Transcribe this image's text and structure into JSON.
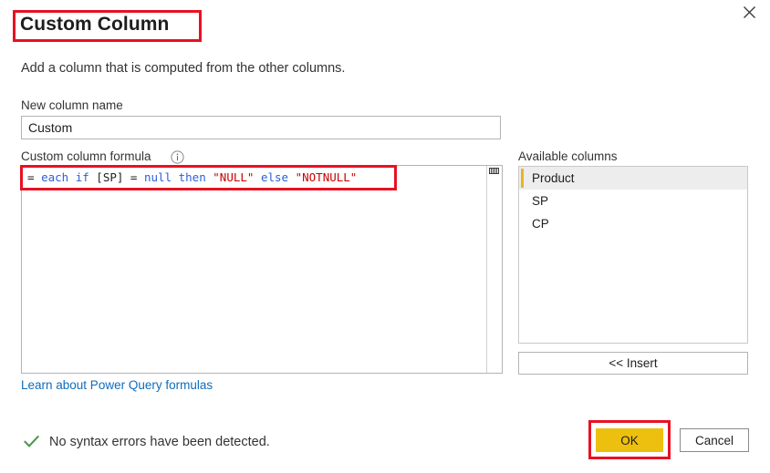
{
  "dialog": {
    "title": "Custom Column",
    "description": "Add a column that is computed from the other columns.",
    "close_icon": "close-icon"
  },
  "new_column": {
    "label": "New column name",
    "value": "Custom",
    "placeholder": "Custom"
  },
  "formula": {
    "label": "Custom column formula",
    "info_icon": "info-icon",
    "text": "= each if [SP] = null then \"NULL\" else \"NOTNULL\"",
    "tokens": [
      {
        "text": "= ",
        "kind": "op"
      },
      {
        "text": "each",
        "kind": "kw"
      },
      {
        "text": " ",
        "kind": "op"
      },
      {
        "text": "if",
        "kind": "kw"
      },
      {
        "text": " [SP] = ",
        "kind": "op"
      },
      {
        "text": "null",
        "kind": "kw"
      },
      {
        "text": " ",
        "kind": "op"
      },
      {
        "text": "then",
        "kind": "kw"
      },
      {
        "text": " ",
        "kind": "op"
      },
      {
        "text": "\"NULL\"",
        "kind": "str"
      },
      {
        "text": " ",
        "kind": "op"
      },
      {
        "text": "else",
        "kind": "kw"
      },
      {
        "text": " ",
        "kind": "op"
      },
      {
        "text": "\"NOTNULL\"",
        "kind": "str"
      }
    ],
    "keyword_color": "#2b5fd9",
    "string_color": "#cc0000"
  },
  "learn_link": {
    "label": "Learn about Power Query formulas",
    "color": "#0f6cbd"
  },
  "available_columns": {
    "label": "Available columns",
    "items": [
      {
        "label": "Product",
        "selected": true
      },
      {
        "label": "SP",
        "selected": false
      },
      {
        "label": "CP",
        "selected": false
      }
    ],
    "selection_accent_color": "#e8b520",
    "selection_background": "#ededed"
  },
  "insert_button": {
    "label": "<< Insert"
  },
  "status": {
    "icon": "checkmark-icon",
    "text": "No syntax errors have been detected.",
    "icon_color": "#4a9a4a"
  },
  "footer": {
    "ok_label": "OK",
    "ok_color": "#edc010",
    "cancel_label": "Cancel"
  },
  "annotations": {
    "color": "#e81123",
    "boxes": [
      "title",
      "formula",
      "ok-button"
    ]
  }
}
